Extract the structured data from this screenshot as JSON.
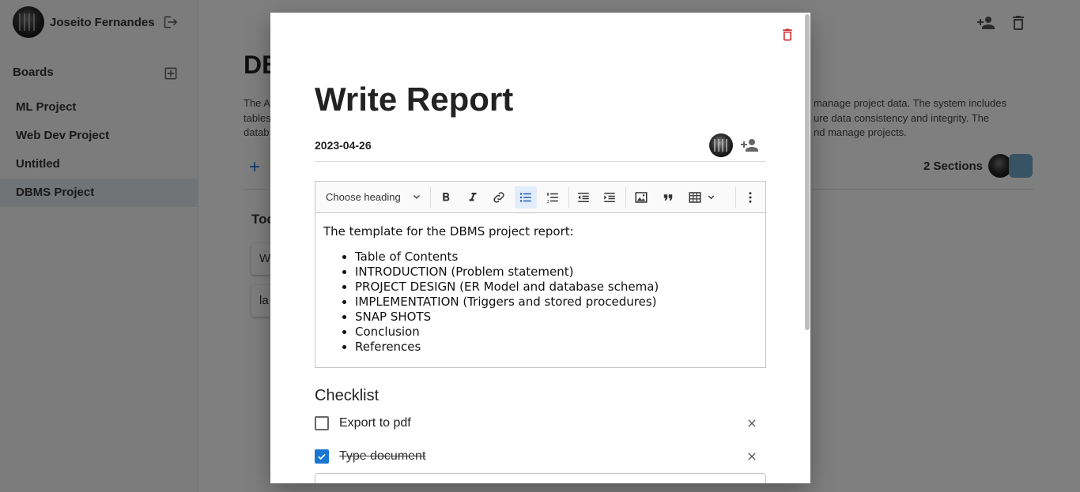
{
  "user": {
    "name": "Joseito Fernandes"
  },
  "sidebar": {
    "boards_label": "Boards",
    "items": [
      {
        "label": "ML Project",
        "active": false
      },
      {
        "label": "Web Dev Project",
        "active": false
      },
      {
        "label": "Untitled",
        "active": false
      },
      {
        "label": "DBMS Project",
        "active": true
      }
    ]
  },
  "board": {
    "title_visible": "DB",
    "desc_lines": [
      "The A",
      "tables",
      "datab"
    ],
    "desc_right_lines": [
      "manage project data. The system includes",
      "ure data consistency and integrity. The",
      "nd manage projects."
    ],
    "sections_count": "2 Sections",
    "section_title": "Toc",
    "cards": [
      "W",
      "la"
    ]
  },
  "modal": {
    "title": "Write Report",
    "date": "2023-04-26",
    "editor": {
      "heading_select": "Choose heading",
      "intro": "The template for the DBMS project report:",
      "bullets": [
        "Table of Contents",
        "INTRODUCTION (Problem statement)",
        "PROJECT DESIGN (ER Model and database schema)",
        "IMPLEMENTATION (Triggers and stored procedures)",
        "SNAP SHOTS",
        "Conclusion",
        "References"
      ]
    },
    "checklist": {
      "title": "Checklist",
      "items": [
        {
          "label": "Export to pdf",
          "checked": false
        },
        {
          "label": "Type document",
          "checked": true
        }
      ]
    }
  },
  "colors": {
    "accent": "#1976d2",
    "danger": "#d32f2f",
    "active_board_bg": "#e3e8ee"
  }
}
